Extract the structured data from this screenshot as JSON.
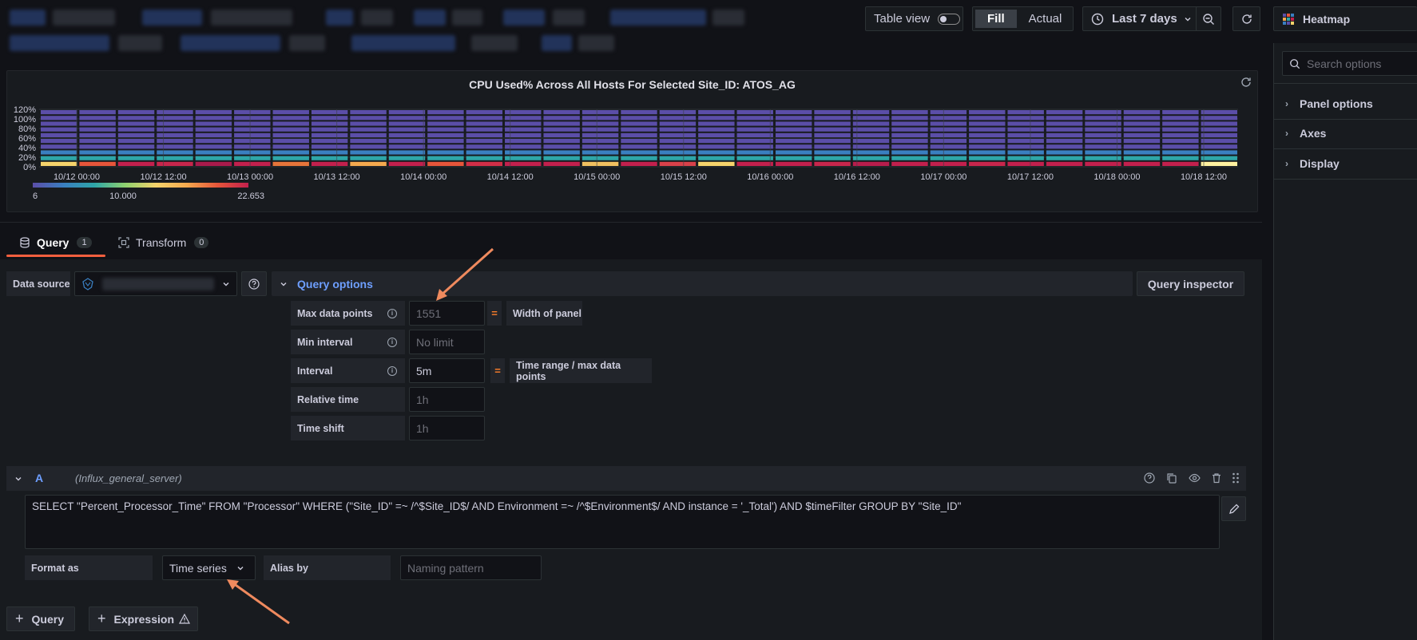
{
  "toolbar": {
    "table_view_label": "Table view",
    "fill_label": "Fill",
    "actual_label": "Actual",
    "time_range_label": "Last 7 days",
    "viz_label": "Heatmap"
  },
  "panel": {
    "title": "CPU Used% Across All Hosts For Selected Site_ID: ATOS_AG",
    "y_ticks": [
      "120%",
      "100%",
      "80%",
      "60%",
      "40%",
      "20%",
      "0%"
    ],
    "x_ticks": [
      "10/12 00:00",
      "10/12 12:00",
      "10/13 00:00",
      "10/13 12:00",
      "10/14 00:00",
      "10/14 12:00",
      "10/15 00:00",
      "10/15 12:00",
      "10/16 00:00",
      "10/16 12:00",
      "10/17 00:00",
      "10/17 12:00",
      "10/18 00:00",
      "10/18 12:00"
    ],
    "legend_min": "6",
    "legend_mid": "10.000",
    "legend_max": "22.653"
  },
  "chart_data": {
    "type": "heatmap",
    "title": "CPU Used% Across All Hosts For Selected Site_ID: ATOS_AG",
    "y_buckets": [
      "0%",
      "20%",
      "40%",
      "60%",
      "80%",
      "100%",
      "120%"
    ],
    "ylim": [
      0,
      120
    ],
    "x_categories": [
      "10/12 00:00",
      "10/12 12:00",
      "10/13 00:00",
      "10/13 12:00",
      "10/14 00:00",
      "10/14 12:00",
      "10/15 00:00",
      "10/15 12:00",
      "10/16 00:00",
      "10/16 12:00",
      "10/17 00:00",
      "10/17 12:00",
      "10/18 00:00",
      "10/18 12:00"
    ],
    "color_scale": {
      "min": 6,
      "mid": 10.0,
      "max": 22.653
    },
    "bottom_row_palette": [
      "#f5d36b",
      "#e6553a",
      "#c2204d",
      "#c7264c",
      "#a81a4b",
      "#c2204d",
      "#e6753a",
      "#c2204d",
      "#f4a94e",
      "#c2204d",
      "#e6553a",
      "#d12e47",
      "#c2204d",
      "#c2204d",
      "#f0c060",
      "#c2204d",
      "#d8414a",
      "#f5d36b",
      "#c2204d",
      "#c2204d",
      "#c7264c",
      "#b81d4c",
      "#c2204d",
      "#c2204d",
      "#c7264c",
      "#c2204d",
      "#c2204d",
      "#c2204d",
      "#c2204d",
      "#c2204d",
      "#fff1a0"
    ],
    "second_row_color": "#2ea6a8",
    "third_row_color": "#3a7fc0",
    "upper_rows_color": "#5b4ea8",
    "grid": true
  },
  "sidebar": {
    "search_placeholder": "Search options",
    "items": [
      "Panel options",
      "Axes",
      "Display"
    ]
  },
  "tabs": {
    "query_label": "Query",
    "query_count": "1",
    "transform_label": "Transform",
    "transform_count": "0"
  },
  "query": {
    "data_source_label": "Data source",
    "query_options_label": "Query options",
    "query_inspector_label": "Query inspector",
    "max_data_points_label": "Max data points",
    "max_data_points_value": "1551",
    "width_of_panel_label": "Width of panel",
    "min_interval_label": "Min interval",
    "min_interval_placeholder": "No limit",
    "interval_label": "Interval",
    "interval_value": "5m",
    "interval_note": "Time range / max data points",
    "relative_time_label": "Relative time",
    "relative_time_placeholder": "1h",
    "time_shift_label": "Time shift",
    "time_shift_placeholder": "1h",
    "eq_symbol": "=",
    "row_letter": "A",
    "row_datasource": "(Influx_general_server)",
    "sql": "SELECT \"Percent_Processor_Time\" FROM \"Processor\" WHERE (\"Site_ID\" =~ /^$Site_ID$/ AND Environment =~ /^$Environment$/  AND instance = '_Total') AND $timeFilter GROUP BY \"Site_ID\"",
    "format_as_label": "Format as",
    "format_as_value": "Time series",
    "alias_by_label": "Alias by",
    "alias_placeholder": "Naming pattern"
  },
  "footer": {
    "add_query_label": "Query",
    "add_expression_label": "Expression"
  }
}
